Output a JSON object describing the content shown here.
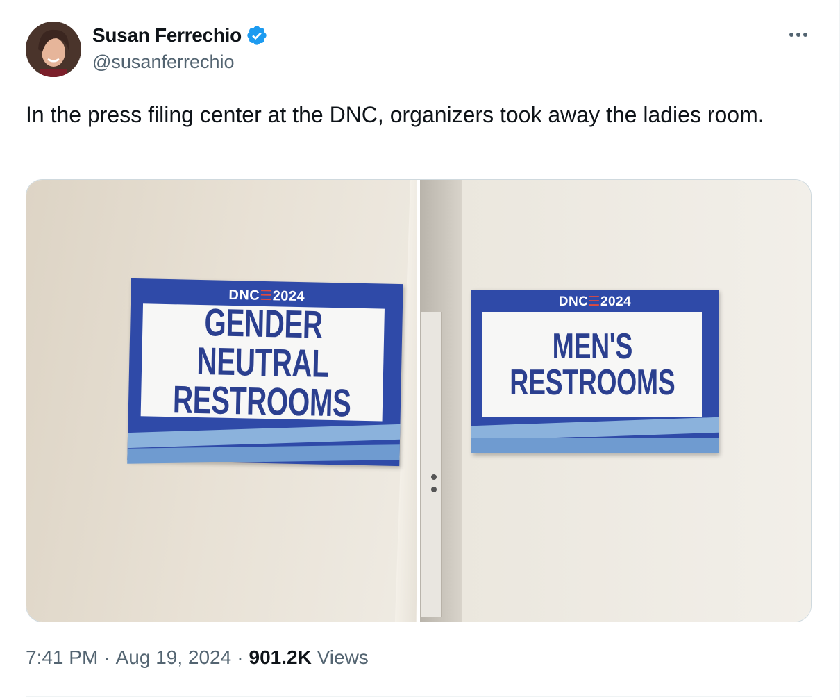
{
  "author": {
    "display_name": "Susan Ferrechio",
    "handle": "@susanferrechio",
    "verified": true,
    "avatar_icon": "profile-photo"
  },
  "tweet": {
    "text": "In the press filing center at the DNC, organizers took away the ladies room."
  },
  "media": [
    {
      "sign_header_left": "DNC",
      "sign_header_right": "2024",
      "sign_text_line1": "GENDER NEUTRAL",
      "sign_text_line2": "RESTROOMS"
    },
    {
      "sign_header_left": "DNC",
      "sign_header_right": "2024",
      "sign_text_line1": "MEN'S",
      "sign_text_line2": "RESTROOMS"
    }
  ],
  "meta": {
    "time": "7:41 PM",
    "separator": "·",
    "date": "Aug 19, 2024",
    "views_count": "901.2K",
    "views_label": "Views"
  },
  "colors": {
    "verified_blue": "#1d9bf0",
    "sign_blue": "#2f4aa8",
    "text_secondary": "#536471"
  }
}
